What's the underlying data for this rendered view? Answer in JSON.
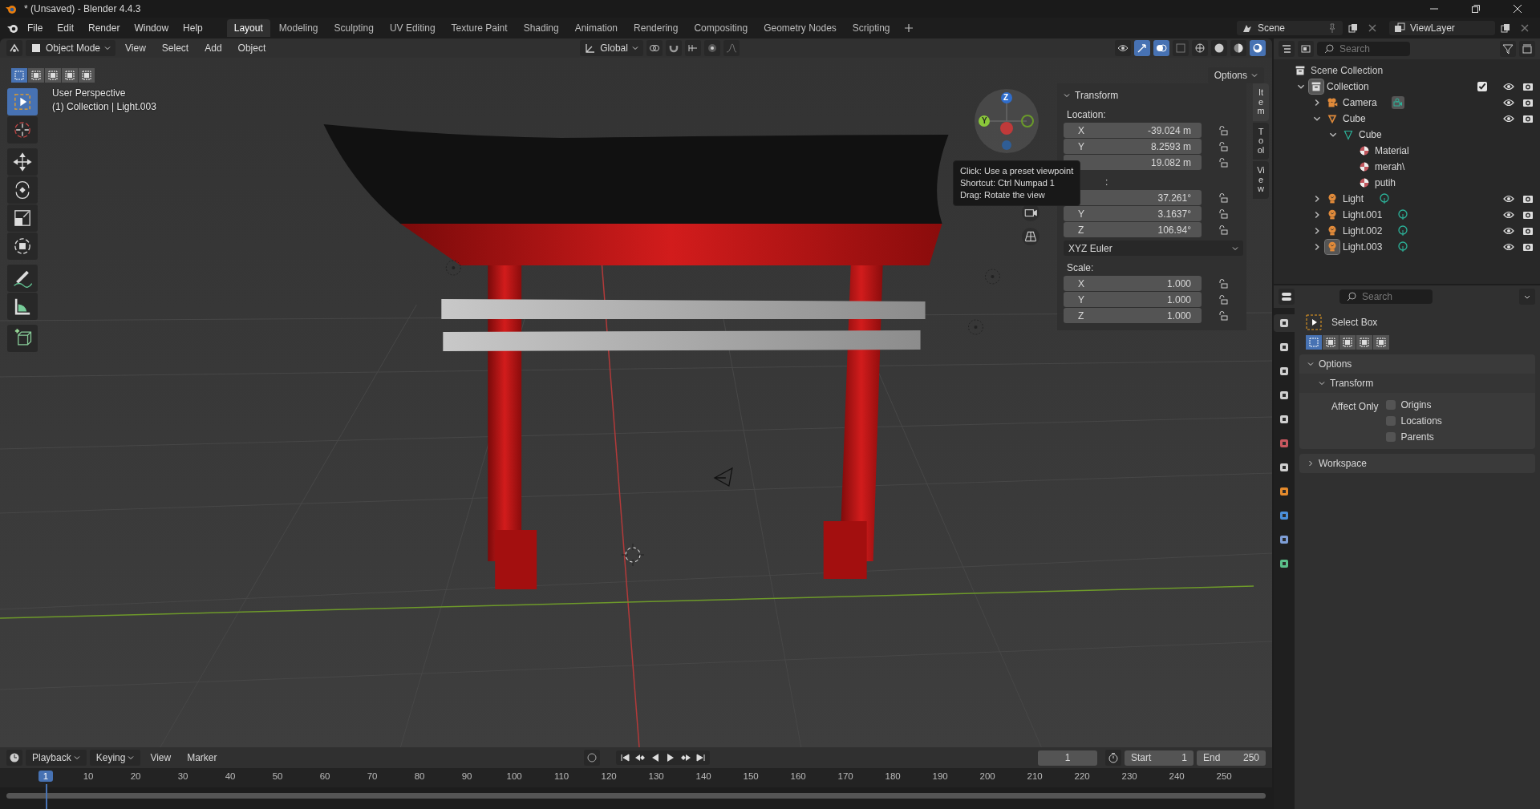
{
  "window": {
    "title": "* (Unsaved) - Blender 4.4.3"
  },
  "menu": [
    "File",
    "Edit",
    "Render",
    "Window",
    "Help"
  ],
  "workspaces": [
    {
      "label": "Layout",
      "selected": true
    },
    {
      "label": "Modeling",
      "selected": false
    },
    {
      "label": "Sculpting",
      "selected": false
    },
    {
      "label": "UV Editing",
      "selected": false
    },
    {
      "label": "Texture Paint",
      "selected": false
    },
    {
      "label": "Shading",
      "selected": false
    },
    {
      "label": "Animation",
      "selected": false
    },
    {
      "label": "Rendering",
      "selected": false
    },
    {
      "label": "Compositing",
      "selected": false
    },
    {
      "label": "Geometry Nodes",
      "selected": false
    },
    {
      "label": "Scripting",
      "selected": false
    }
  ],
  "scene": "Scene",
  "view_layer": "ViewLayer",
  "viewport_header": {
    "mode": "Object Mode",
    "menus": [
      "View",
      "Select",
      "Add",
      "Object"
    ],
    "orientation": "Global"
  },
  "tool_settings": {
    "select_modes": [
      {
        "selected": true
      },
      {
        "selected": false
      },
      {
        "selected": false
      },
      {
        "selected": false
      },
      {
        "selected": false
      }
    ],
    "options": "Options"
  },
  "tools": [
    {
      "kind": "select",
      "selected": true
    },
    {
      "kind": "cursor",
      "selected": false
    },
    {
      "kind": "move",
      "selected": false
    },
    {
      "kind": "rotate",
      "selected": false
    },
    {
      "kind": "scale",
      "selected": false
    },
    {
      "kind": "transform",
      "selected": false
    },
    {
      "kind": "annotate",
      "selected": false
    },
    {
      "kind": "measure",
      "selected": false
    },
    {
      "kind": "add_cube",
      "selected": false
    }
  ],
  "viewport": {
    "view_name": "User Perspective",
    "context": "(1) Collection | Light.003",
    "gizmo_axes": [
      "Z",
      "Y"
    ]
  },
  "tooltip": [
    "Click: Use a preset viewpoint",
    "Shortcut: Ctrl Numpad 1",
    "Drag: Rotate the view"
  ],
  "sidebar_tabs": [
    {
      "label": "Item",
      "selected": true
    },
    {
      "label": "Tool",
      "selected": false
    },
    {
      "label": "View",
      "selected": false
    }
  ],
  "transform": {
    "title": "Transform",
    "groups": [
      {
        "label": "Location:",
        "rows": [
          {
            "axis": "X",
            "value": "-39.024 m"
          },
          {
            "axis": "Y",
            "value": "8.2593 m"
          },
          {
            "value": "19.082 m"
          }
        ]
      },
      {
        "label": ":",
        "rows": [
          {
            "value": "37.261°"
          },
          {
            "axis": "Y",
            "value": "3.1637°"
          },
          {
            "axis": "Z",
            "value": "106.94°"
          }
        ],
        "mode": "XYZ Euler"
      },
      {
        "label": "Scale:",
        "rows": [
          {
            "axis": "X",
            "value": "1.000"
          },
          {
            "axis": "Y",
            "value": "1.000"
          },
          {
            "axis": "Z",
            "value": "1.000"
          }
        ]
      }
    ]
  },
  "outliner": {
    "search": {
      "placeholder": "Search"
    },
    "tree": [
      {
        "kind": "scene_collection",
        "name": "Scene Collection",
        "selected": false,
        "children": [
          {
            "kind": "collection",
            "name": "Collection",
            "selected": true,
            "checked": true,
            "expanded": true,
            "children": [
              {
                "kind": "camera",
                "name": "Camera",
                "selected": false,
                "expanded": false
              },
              {
                "kind": "object_mesh",
                "name": "Cube",
                "selected": false,
                "expanded": true,
                "children": [
                  {
                    "kind": "mesh",
                    "name": "Cube",
                    "selected": false,
                    "expanded": true,
                    "children": [
                      {
                        "kind": "material",
                        "name": "Material",
                        "selected": false
                      },
                      {
                        "kind": "material",
                        "name": "merah\\",
                        "selected": false
                      },
                      {
                        "kind": "material",
                        "name": "putih",
                        "selected": false
                      }
                    ]
                  }
                ]
              },
              {
                "kind": "light",
                "name": "Light",
                "selected": false,
                "expanded": false
              },
              {
                "kind": "light",
                "name": "Light.001",
                "selected": false,
                "expanded": false
              },
              {
                "kind": "light",
                "name": "Light.002",
                "selected": false,
                "expanded": false
              },
              {
                "kind": "light",
                "name": "Light.003",
                "selected": true,
                "expanded": false
              }
            ]
          }
        ]
      }
    ]
  },
  "properties": {
    "search": {
      "placeholder": "Search"
    },
    "tabs": [
      {
        "kind": "tool",
        "selected": true
      },
      {
        "kind": "render",
        "selected": false
      },
      {
        "kind": "output",
        "selected": false
      },
      {
        "kind": "view_layer",
        "selected": false
      },
      {
        "kind": "scene",
        "selected": false
      },
      {
        "kind": "world",
        "selected": false
      },
      {
        "kind": "collection",
        "selected": false
      },
      {
        "kind": "object",
        "selected": false
      },
      {
        "kind": "physics",
        "selected": false
      },
      {
        "kind": "constraints",
        "selected": false
      },
      {
        "kind": "data",
        "selected": false
      }
    ],
    "tool_name": "Select Box",
    "modes": [
      {
        "selected": true
      },
      {
        "selected": false
      },
      {
        "selected": false
      },
      {
        "selected": false
      },
      {
        "selected": false
      }
    ],
    "options": {
      "title": "Options",
      "expanded": true,
      "sub": {
        "title": "Transform",
        "expanded": true
      },
      "affect_label": "Affect Only",
      "checks": [
        {
          "label": "Origins",
          "checked": false
        },
        {
          "label": "Locations",
          "checked": false
        },
        {
          "label": "Parents",
          "checked": false
        }
      ]
    },
    "workspace": {
      "title": "Workspace",
      "expanded": false
    }
  },
  "timeline": {
    "menus": [
      "Playback",
      "Keying",
      "View",
      "Marker"
    ],
    "current_frame": "1",
    "start_label": "Start",
    "start": "1",
    "end_label": "End",
    "end": "250",
    "ruler": [
      {
        "label": "1",
        "selected": true
      },
      {
        "label": "10",
        "selected": false
      },
      {
        "label": "20",
        "selected": false
      },
      {
        "label": "30",
        "selected": false
      },
      {
        "label": "40",
        "selected": false
      },
      {
        "label": "50",
        "selected": false
      },
      {
        "label": "60",
        "selected": false
      },
      {
        "label": "70",
        "selected": false
      },
      {
        "label": "80",
        "selected": false
      },
      {
        "label": "90",
        "selected": false
      },
      {
        "label": "100",
        "selected": false
      },
      {
        "label": "110",
        "selected": false
      },
      {
        "label": "120",
        "selected": false
      },
      {
        "label": "130",
        "selected": false
      },
      {
        "label": "140",
        "selected": false
      },
      {
        "label": "150",
        "selected": false
      },
      {
        "label": "160",
        "selected": false
      },
      {
        "label": "170",
        "selected": false
      },
      {
        "label": "180",
        "selected": false
      },
      {
        "label": "190",
        "selected": false
      },
      {
        "label": "200",
        "selected": false
      },
      {
        "label": "210",
        "selected": false
      },
      {
        "label": "220",
        "selected": false
      },
      {
        "label": "230",
        "selected": false
      },
      {
        "label": "240",
        "selected": false
      },
      {
        "label": "250",
        "selected": false
      }
    ]
  }
}
